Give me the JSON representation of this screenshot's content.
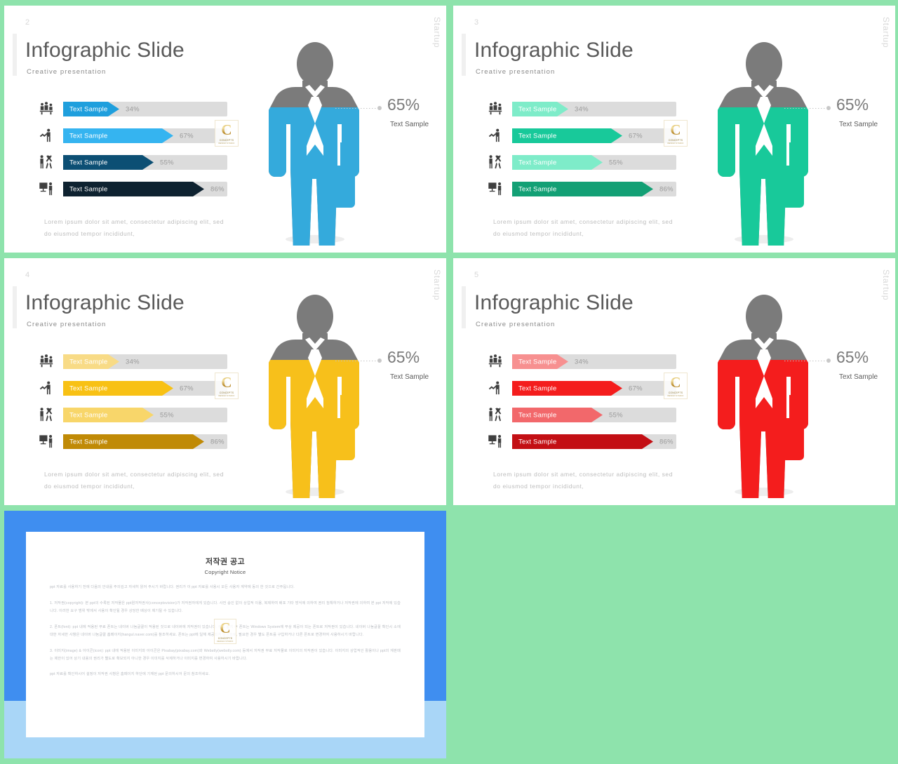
{
  "theme": {
    "background": "#8ee3ac",
    "slide_bg": "#ffffff",
    "track_color": "#dcdcdc",
    "pct_text_color": "#9a9a9a",
    "title_color": "#595959"
  },
  "watermark": {
    "letter": "C",
    "line1": "CONCEPTS",
    "line2": "DESIGN  STUDIO",
    "gold": "#c9a227"
  },
  "slides": [
    {
      "number": "2",
      "side_label": "Startup",
      "title": "Infographic Slide",
      "subtitle": "Creative  presentation",
      "accent": "#34aadc",
      "figure_fill": "#34aadc",
      "figure_head": "#7b7b7b",
      "callout": {
        "percent": "65%",
        "label": "Text Sample"
      },
      "body_text": "Lorem  ipsum  dolor  sit amet,  consectetur  adipiscing  elit,  sed  do eiusmod  tempor  incididunt,",
      "rows": [
        {
          "icon": "team-meeting-icon",
          "label": "Text Sample",
          "percent": "34%",
          "value": 34,
          "color": "#1f9fdd"
        },
        {
          "icon": "person-chart-icon",
          "label": "Text Sample",
          "percent": "67%",
          "value": 67,
          "color": "#35b4f0"
        },
        {
          "icon": "people-celebrate-icon",
          "label": "Text Sample",
          "percent": "55%",
          "value": 55,
          "color": "#0c4f74"
        },
        {
          "icon": "presentation-icon",
          "label": "Text Sample",
          "percent": "86%",
          "value": 86,
          "color": "#0e2230"
        }
      ]
    },
    {
      "number": "3",
      "side_label": "Startup",
      "title": "Infographic Slide",
      "subtitle": "Creative  presentation",
      "accent": "#18c99a",
      "figure_fill": "#18c99a",
      "figure_head": "#7b7b7b",
      "callout": {
        "percent": "65%",
        "label": "Text Sample"
      },
      "body_text": "Lorem  ipsum  dolor  sit amet,  consectetur  adipiscing  elit,  sed  do eiusmod  tempor  incididunt,",
      "rows": [
        {
          "icon": "team-meeting-icon",
          "label": "Text Sample",
          "percent": "34%",
          "value": 34,
          "color": "#7eecc9"
        },
        {
          "icon": "person-chart-icon",
          "label": "Text Sample",
          "percent": "67%",
          "value": 67,
          "color": "#18c99a"
        },
        {
          "icon": "people-celebrate-icon",
          "label": "Text Sample",
          "percent": "55%",
          "value": 55,
          "color": "#7eecc9"
        },
        {
          "icon": "presentation-icon",
          "label": "Text Sample",
          "percent": "86%",
          "value": 86,
          "color": "#13a075"
        }
      ]
    },
    {
      "number": "4",
      "side_label": "Startup",
      "title": "Infographic Slide",
      "subtitle": "Creative  presentation",
      "accent": "#f7c01b",
      "figure_fill": "#f7c01b",
      "figure_head": "#7b7b7b",
      "callout": {
        "percent": "65%",
        "label": "Text Sample"
      },
      "body_text": "Lorem  ipsum  dolor  sit amet,  consectetur  adipiscing  elit,  sed  do eiusmod  tempor  incididunt,",
      "rows": [
        {
          "icon": "team-meeting-icon",
          "label": "Text Sample",
          "percent": "34%",
          "value": 34,
          "color": "#f8db86"
        },
        {
          "icon": "person-chart-icon",
          "label": "Text Sample",
          "percent": "67%",
          "value": 67,
          "color": "#f8c114"
        },
        {
          "icon": "people-celebrate-icon",
          "label": "Text Sample",
          "percent": "55%",
          "value": 55,
          "color": "#f8d66a"
        },
        {
          "icon": "presentation-icon",
          "label": "Text Sample",
          "percent": "86%",
          "value": 86,
          "color": "#c08a06"
        }
      ]
    },
    {
      "number": "5",
      "side_label": "Startup",
      "title": "Infographic Slide",
      "subtitle": "Creative  presentation",
      "accent": "#f41d1d",
      "figure_fill": "#f41d1d",
      "figure_head": "#7b7b7b",
      "callout": {
        "percent": "65%",
        "label": "Text Sample"
      },
      "body_text": "Lorem  ipsum  dolor  sit amet,  consectetur  adipiscing  elit,  sed  do eiusmod  tempor  incididunt,",
      "rows": [
        {
          "icon": "team-meeting-icon",
          "label": "Text Sample",
          "percent": "34%",
          "value": 34,
          "color": "#f79090"
        },
        {
          "icon": "person-chart-icon",
          "label": "Text Sample",
          "percent": "67%",
          "value": 67,
          "color": "#f41d1d"
        },
        {
          "icon": "people-celebrate-icon",
          "label": "Text Sample",
          "percent": "55%",
          "value": 55,
          "color": "#f2686b"
        },
        {
          "icon": "presentation-icon",
          "label": "Text Sample",
          "percent": "86%",
          "value": 86,
          "color": "#c30f14"
        }
      ]
    }
  ],
  "copyright_slide": {
    "title_kr": "저작권 공고",
    "title_en": "Copyright Notice",
    "paragraphs": [
      "ppt 자료를 사용하기 전에 다음의 안내를 주의깊고 자세히 읽어 주시기 바랍니다. 권리가 이 ppt 자료를 사용시 모든 사용자 계약에 동의 한 것으로 간주됩니다.",
      "1. 저작권(copyright): 본 ppt의 수록된 저작물은 ppt원저작권사(conceptsvision)가 저작권자에게 있습니다. 사전 승인 없이 상업적 이용, 복제하여 배포 기타 방식에 의하여 권리 침해하거나 저작권에 의하여 본 ppt 저작에 있습니다. 이러한 요구 범위 밖에서 사용이 확인될 경우 상당한 배상이 제기될 수 있습니다.",
      "2. 폰트(font): ppt 내에 적용된 무료 폰트는 네이버 나눔글꼴이 적용된 것으로 네이버에 저작권이 있습니다. 무료 설치 후 폰트는 Windows System에 무상 제공이 되는 폰트로 저작권이 있습니다. 네이버 나눔글꼴 확인시 소에 대한 자세한 사항은 네이버 나눔글꼴 홈페이지(hangul.naver.com)를 참조하세요. 폰트는 ppt에 일체 제공되지 않으므로, 필요한 경우 별도 폰트를 구입하거나 다른 폰트로 변경하여 사용하시기 바랍니다.",
      "3. 이미지(image) & 아이콘(icon): ppt 내에 적용된 이미지와 아이콘은 Pixabay(pixabay.com)와 Webstly(webstly.com) 등에서 저작권 무료 저작물로 이미지의 저작권이 있습니다. 이미지의 상업적인 활용이나 ppt의 재판매는 제한이 있어 상기 내용의 권리가 별도로 확보되지 아니한 경우 이미지를 삭제하거나 이미지를 변경하여 사용하시기 바랍니다.",
      "ppt 자료를 확인하시어 설정이 저작권 사항은 홈페이지 하단에 기재된 ppt 문의하시어 문의 참조하세요."
    ]
  }
}
